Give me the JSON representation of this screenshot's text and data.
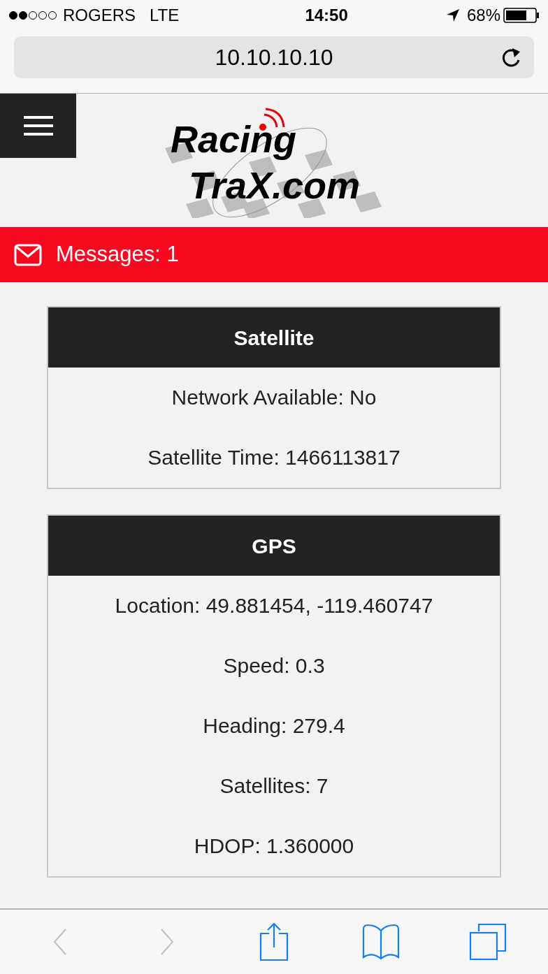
{
  "status_bar": {
    "carrier": "ROGERS",
    "network": "LTE",
    "time": "14:50",
    "battery": "68%"
  },
  "address_bar": {
    "url": "10.10.10.10"
  },
  "logo": {
    "line1": "Racing",
    "line2": "TraX.com"
  },
  "messages": {
    "label": "Messages:",
    "count": "1"
  },
  "panels": [
    {
      "title": "Satellite",
      "lines": [
        "Network Available: No",
        "Satellite Time: 1466113817"
      ]
    },
    {
      "title": "GPS",
      "lines": [
        "Location: 49.881454, -119.460747",
        "Speed: 0.3",
        "Heading: 279.4",
        "Satellites: 7",
        "HDOP: 1.360000"
      ]
    }
  ],
  "toolbar": [
    {
      "kind": "back",
      "disabled": true
    },
    {
      "kind": "forward",
      "disabled": true
    },
    {
      "kind": "share",
      "disabled": false
    },
    {
      "kind": "bookmarks",
      "disabled": false
    },
    {
      "kind": "tabs",
      "disabled": false
    }
  ]
}
